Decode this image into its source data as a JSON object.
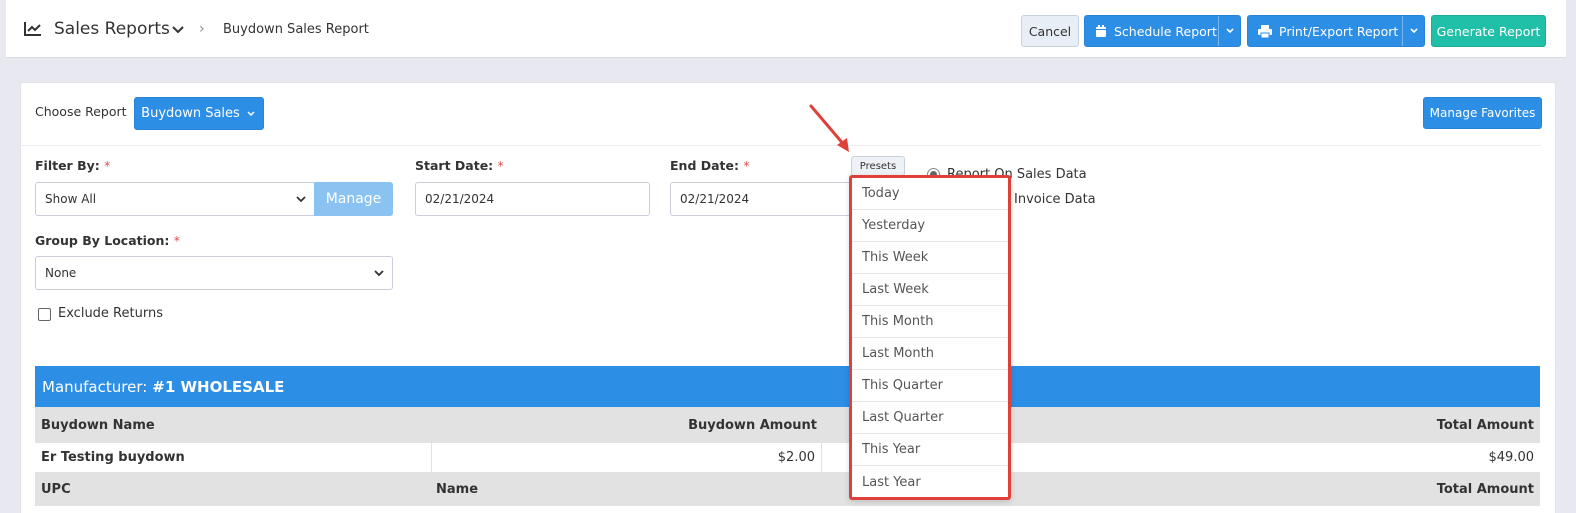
{
  "header": {
    "title": "Sales Reports",
    "breadcrumb_separator": "›",
    "breadcrumb": "Buydown Sales Report",
    "cancel_label": "Cancel",
    "schedule_label": "Schedule Report",
    "print_label": "Print/Export Report",
    "generate_label": "Generate Report"
  },
  "report": {
    "choose_label": "Choose Report",
    "selected_report": "Buydown Sales",
    "manage_favorites_label": "Manage Favorites"
  },
  "filters": {
    "filter_by_label": "Filter By:",
    "required_mark": "*",
    "filter_by_value": "Show All",
    "manage_label": "Manage",
    "start_date_label": "Start Date:",
    "start_date_value": "02/21/2024",
    "end_date_label": "End Date:",
    "end_date_value": "02/21/2024",
    "group_by_label": "Group By Location:",
    "group_by_value": "None",
    "exclude_returns_label": "Exclude Returns",
    "exclude_returns_checked": false,
    "presets_label": "Presets",
    "report_on_sales_label": "Report On Sales Data",
    "report_on_invoice_label": "Invoice Data"
  },
  "presets_menu": [
    "Today",
    "Yesterday",
    "This Week",
    "Last Week",
    "This Month",
    "Last Month",
    "This Quarter",
    "Last Quarter",
    "This Year",
    "Last Year"
  ],
  "table": {
    "manufacturer_label": "Manufacturer:",
    "manufacturer_name": "#1 WHOLESALE",
    "col_buydown_name": "Buydown Name",
    "col_buydown_amount": "Buydown Amount",
    "col_total_amount": "Total Amount",
    "row_name": "Er Testing buydown",
    "row_amount": "$2.00",
    "row_total": "$49.00",
    "col_upc": "UPC",
    "col_name": "Name",
    "col_total_amount_2": "Total Amount"
  },
  "colors": {
    "primary": "#2d8ee6",
    "teal": "#1fbfa8",
    "highlight": "#e0403a"
  }
}
